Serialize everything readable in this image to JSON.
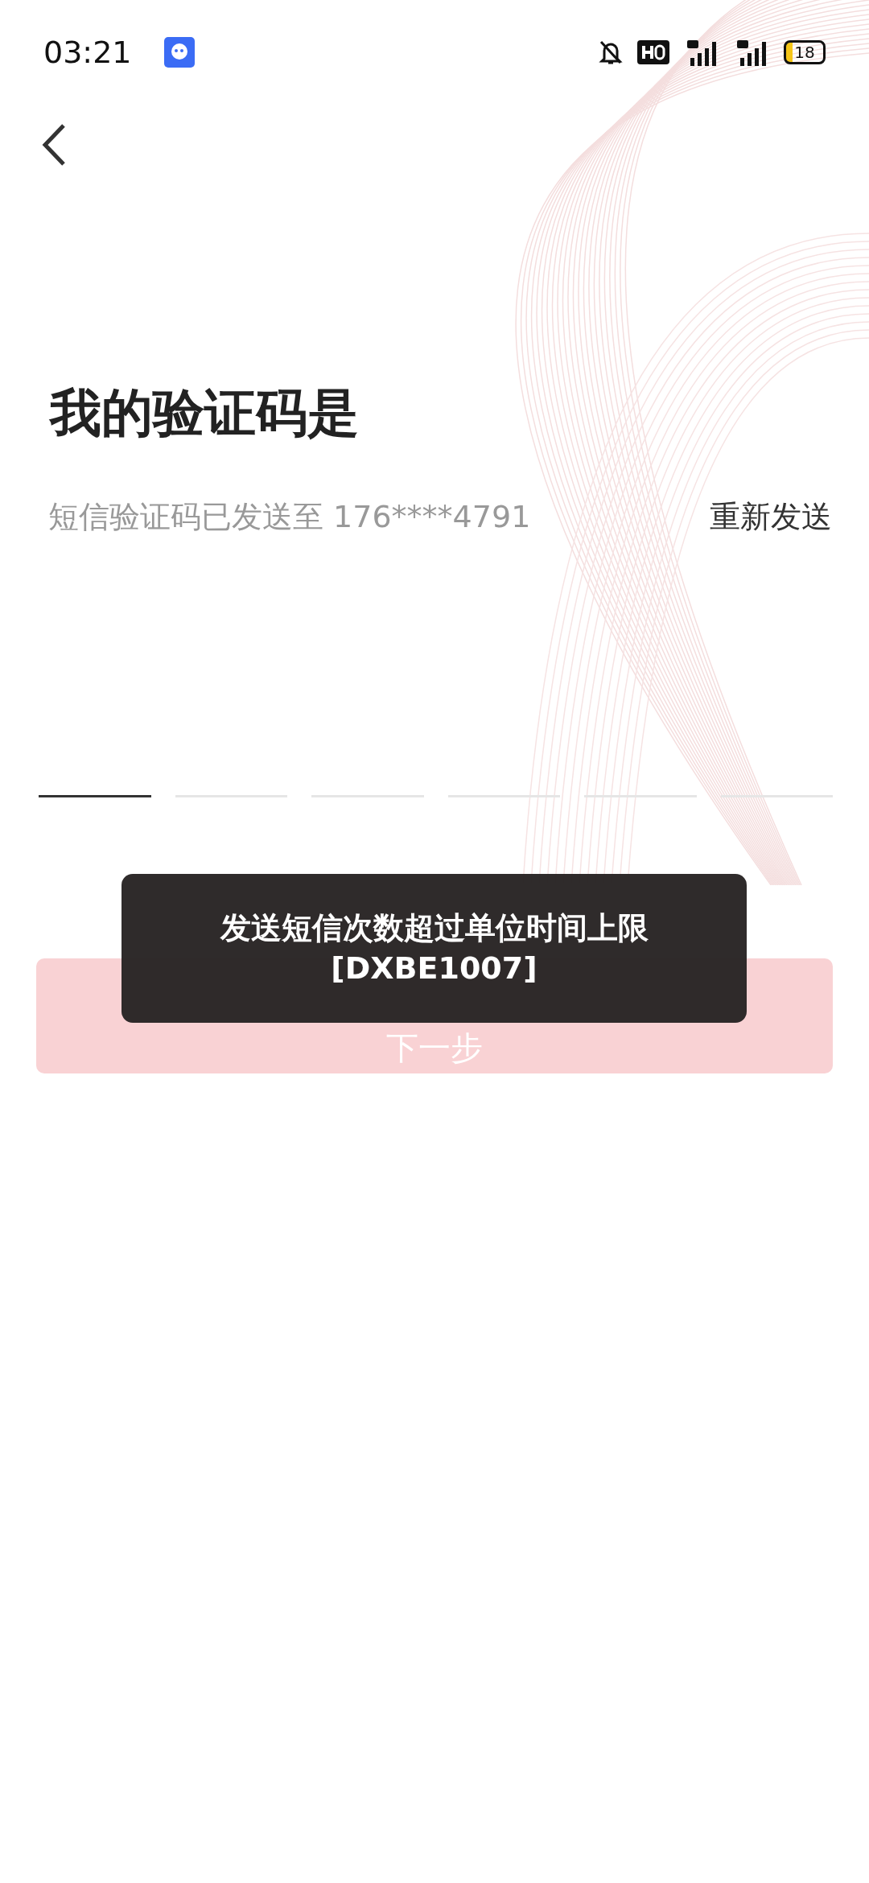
{
  "status_bar": {
    "time": "03:21",
    "battery": "18"
  },
  "title": "我的验证码是",
  "subtitle": "短信验证码已发送至 176****4791",
  "resend": "重新发送",
  "code_slots": [
    {
      "selected": true
    },
    {
      "selected": false
    },
    {
      "selected": false
    },
    {
      "selected": false
    },
    {
      "selected": false
    },
    {
      "selected": false
    }
  ],
  "next_button": {
    "label": "下一步",
    "disabled": true
  },
  "toast": {
    "lines": [
      "发送短信次数超过单位时间上限",
      "[DXBE1007]"
    ]
  }
}
